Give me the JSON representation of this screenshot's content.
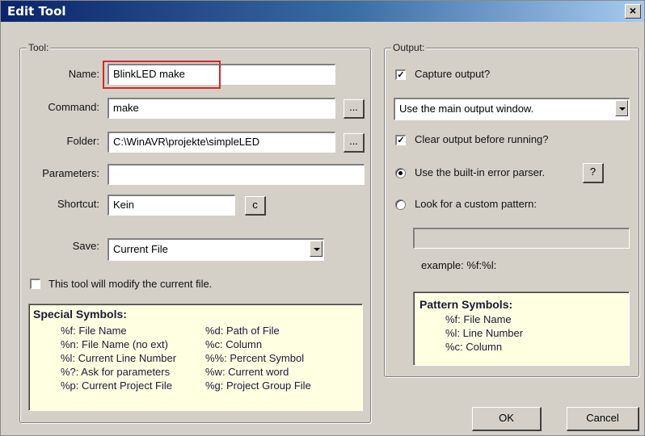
{
  "window": {
    "title": "Edit Tool",
    "close_glyph": "×"
  },
  "tool_group": {
    "title": "Tool:",
    "name": {
      "label": "Name:",
      "value": "BlinkLED make"
    },
    "command": {
      "label": "Command:",
      "value": "make",
      "browse_label": "..."
    },
    "folder": {
      "label": "Folder:",
      "value": "C:\\WinAVR\\projekte\\simpleLED",
      "browse_label": "..."
    },
    "parameters": {
      "label": "Parameters:",
      "value": ""
    },
    "shortcut": {
      "label": "Shortcut:",
      "value": "Kein",
      "clear_label": "c"
    },
    "save": {
      "label": "Save:",
      "value": "Current File"
    },
    "modify_checkbox": {
      "label": "This tool will modify the current file.",
      "checked": false
    },
    "special_symbols": {
      "title": "Special Symbols:",
      "left": [
        "%f: File Name",
        "%n: File Name (no ext)",
        "%l: Current Line Number",
        "%?: Ask for parameters",
        "%p: Current Project File"
      ],
      "right": [
        "%d: Path of File",
        "%c: Column",
        "%%: Percent Symbol",
        "%w: Current word",
        "%g: Project Group File"
      ]
    }
  },
  "output_group": {
    "title": "Output:",
    "capture": {
      "label": "Capture output?",
      "checked": true
    },
    "output_window": {
      "value": "Use the main output window."
    },
    "clear": {
      "label": "Clear output before running?",
      "checked": true
    },
    "builtin_parser": {
      "label": "Use the built-in error parser.",
      "selected": true,
      "help_label": "?"
    },
    "custom_pattern": {
      "label": "Look for a custom pattern:",
      "selected": false,
      "value": ""
    },
    "example": "example: %f:%l:",
    "pattern_symbols": {
      "title": "Pattern Symbols:",
      "items": [
        "%f: File Name",
        "%l: Line Number",
        "%c: Column"
      ]
    }
  },
  "buttons": {
    "ok": "OK",
    "cancel": "Cancel"
  },
  "colors": {
    "highlight": "#d42828",
    "title_bar": "#0a246a",
    "symbols_bg": "#ffffe1"
  }
}
